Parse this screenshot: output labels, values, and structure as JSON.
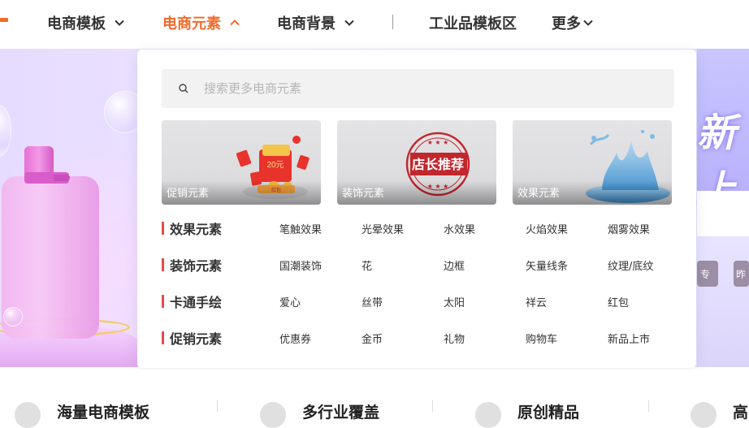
{
  "nav": {
    "items": [
      {
        "label": "电商模板",
        "has_chevron": true,
        "expanded": false
      },
      {
        "label": "电商元素",
        "has_chevron": true,
        "expanded": true
      },
      {
        "label": "电商背景",
        "has_chevron": true,
        "expanded": false
      },
      {
        "label": "工业品模板区",
        "has_chevron": false
      },
      {
        "label": "更多",
        "has_chevron": true,
        "expanded": false
      }
    ],
    "accent_color": "#f26b2a"
  },
  "dropdown": {
    "search": {
      "placeholder": "搜索更多电商元素",
      "value": "",
      "icon": "search-icon"
    },
    "thumbnails": [
      {
        "caption": "促销元素",
        "art_text": "20元",
        "art_text_2": "红包"
      },
      {
        "caption": "装饰元素",
        "art_text": "店长推荐"
      },
      {
        "caption": "效果元素"
      }
    ],
    "categories": [
      {
        "title": "效果元素",
        "links": [
          "笔触效果",
          "光晕效果",
          "水效果",
          "火焰效果",
          "烟雾效果"
        ]
      },
      {
        "title": "装饰元素",
        "links": [
          "国潮装饰",
          "花",
          "边框",
          "矢量线条",
          "纹理/底纹"
        ]
      },
      {
        "title": "卡通手绘",
        "links": [
          "爱心",
          "丝带",
          "太阳",
          "祥云",
          "红包"
        ]
      },
      {
        "title": "促销元素",
        "links": [
          "优惠券",
          "金币",
          "礼物",
          "购物车",
          "新品上市"
        ]
      }
    ],
    "category_bar_color": "#e74b4b"
  },
  "banner": {
    "right_big_text": "新上",
    "right_buttons": [
      "专",
      "昨"
    ]
  },
  "bottom": {
    "items": [
      "海量电商模板",
      "多行业覆盖",
      "原创精品",
      "高"
    ]
  }
}
